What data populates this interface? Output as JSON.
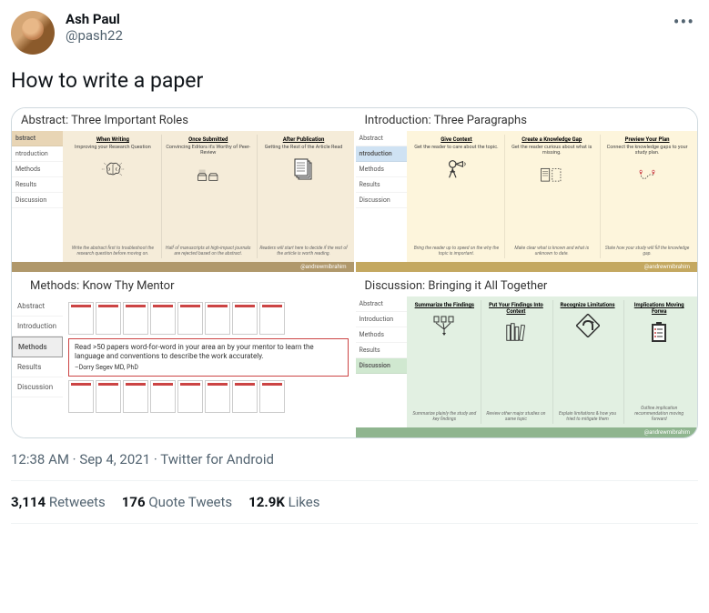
{
  "user": {
    "display_name": "Ash Paul",
    "handle": "@pash22"
  },
  "tweet_text": "How to write a paper",
  "timestamp": "12:38 AM · Sep 4, 2021 · Twitter for Android",
  "stats": {
    "retweets_count": "3,114",
    "retweets_label": "Retweets",
    "quotes_count": "176",
    "quotes_label": "Quote Tweets",
    "likes_count": "12.9K",
    "likes_label": "Likes"
  },
  "more_icon": "•••",
  "credit": "@andrewmibrahim",
  "slides": {
    "abstract": {
      "title": "Abstract: Three Important Roles",
      "nav": [
        "bstract",
        "ntroduction",
        "Methods",
        "Results",
        "Discussion"
      ],
      "cols": [
        {
          "head": "When Writing",
          "sub": "Improving your Research Question",
          "foot": "Write the abstract first to troubleshoot the research question before moving on."
        },
        {
          "head": "Once Submitted",
          "sub": "Convincing Editors it's Worthy of Peer-Review",
          "foot": "Half of manuscripts at high-impact journals are rejected based on the abstract."
        },
        {
          "head": "After Publication",
          "sub": "Getting the Rest of the Article Read",
          "foot": "Readers will start here to decide if the rest of the article is worth reading."
        }
      ]
    },
    "introduction": {
      "title": "Introduction: Three Paragraphs",
      "nav": [
        "Abstract",
        "ntroduction",
        "Methods",
        "Results",
        "Discussion"
      ],
      "cols": [
        {
          "head": "Give Context",
          "sub": "Get the reader to care about the topic.",
          "foot": "Bring the reader up to speed on the why the topic is important."
        },
        {
          "head": "Create a Knowledge Gap",
          "sub": "Get the reader curious about what is missing.",
          "foot": "Make clear what is known and what is unknown to date."
        },
        {
          "head": "Preview Your Plan",
          "sub": "Connect the knowledge gaps to your study plan.",
          "foot": "State how your study will fill the knowledge gap."
        }
      ]
    },
    "methods": {
      "title": "Methods: Know Thy Mentor",
      "nav": [
        "Abstract",
        "Introduction",
        "Methods",
        "Results",
        "Discussion"
      ],
      "quote": "Read >50 papers word-for-word in your area an by your mentor to learn the language and conventions to describe the work accurately.",
      "attribution": "–Dorry Segev MD, PhD"
    },
    "discussion": {
      "title": "Discussion: Bringing it All Together",
      "nav": [
        "Abstract",
        "Introduction",
        "Methods",
        "Results",
        "Discussion"
      ],
      "cols": [
        {
          "head": "Summarize the Findings",
          "foot": "Summarize plainly the study and key findings"
        },
        {
          "head": "Put Your Findings Into Context",
          "foot": "Review other major studies on same topic"
        },
        {
          "head": "Recognize Limitations",
          "foot": "Explain limitations & how you tried to mitigate them"
        },
        {
          "head": "Implications Moving Forwa",
          "foot": "Outline implication recommendation moving forward"
        }
      ]
    }
  }
}
